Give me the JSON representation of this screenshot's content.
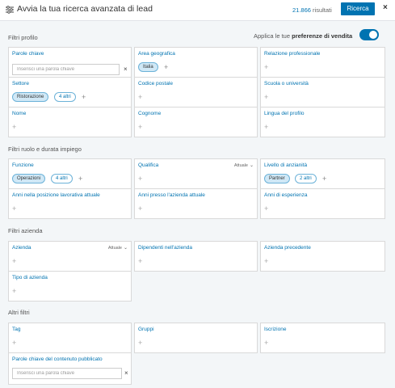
{
  "header": {
    "title": "Avvia la tua ricerca avanzata di lead",
    "result_count": "21.866",
    "result_label": "risultati",
    "search_label": "Ricerca",
    "close_label": "×"
  },
  "profile_section": {
    "title": "Filtri profilo",
    "toggle_prefix": "Applica le tue ",
    "toggle_bold": "preferenze di vendita",
    "toggle_on": true
  },
  "cards": {
    "keywords": {
      "label": "Parole chiave",
      "placeholder": "Inserisci una parola chiave",
      "clear": "×"
    },
    "geo": {
      "label": "Area geografica",
      "pill": "Italia"
    },
    "relationship": {
      "label": "Relazione professionale"
    },
    "sector": {
      "label": "Settore",
      "pill": "Ristorazione",
      "more": "4 altri"
    },
    "postal": {
      "label": "Codice postale"
    },
    "school": {
      "label": "Scuola o università"
    },
    "first_name": {
      "label": "Nome"
    },
    "last_name": {
      "label": "Cognome"
    },
    "profile_lang": {
      "label": "Lingua del profilo"
    },
    "function": {
      "label": "Funzione",
      "pill": "Operazioni",
      "more": "4 altri"
    },
    "title_q": {
      "label": "Qualifica",
      "dropdown": "Attuale"
    },
    "seniority": {
      "label": "Livello di anzianità",
      "pill": "Partner",
      "more": "2 altri"
    },
    "years_position": {
      "label": "Anni nella posizione lavorativa attuale"
    },
    "years_company": {
      "label": "Anni presso l'azienda attuale"
    },
    "experience": {
      "label": "Anni di esperienza"
    },
    "company": {
      "label": "Azienda",
      "dropdown": "Attuale"
    },
    "employees": {
      "label": "Dipendenti nell'azienda"
    },
    "prev_company": {
      "label": "Azienda precedente"
    },
    "company_type": {
      "label": "Tipo di azienda"
    },
    "tag": {
      "label": "Tag"
    },
    "groups": {
      "label": "Gruppi"
    },
    "subscription": {
      "label": "Iscrizione"
    },
    "post_keywords": {
      "label": "Parole chiave del contenuto pubblicato",
      "placeholder": "Inserisci una parola chiave",
      "clear": "×"
    }
  },
  "sections": {
    "role": "Filtri ruolo e durata impiego",
    "company": "Filtri azienda",
    "other": "Altri filtri"
  },
  "plus_symbol": "+",
  "chevron": "⌄",
  "accent_color": "#0073b1"
}
